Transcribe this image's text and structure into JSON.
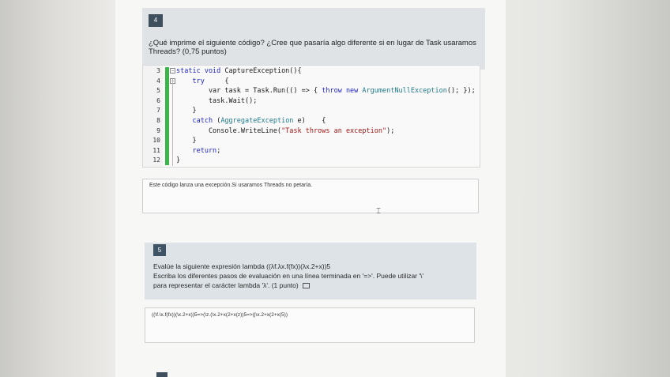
{
  "question4": {
    "number": "4",
    "prompt": "¿Qué imprime el siguiente código? ¿Cree que pasaría algo diferente si en lugar de Task usaramos Threads? (0,75 puntos)",
    "code_lines": [
      {
        "n": "3",
        "parts": [
          {
            "t": "static void ",
            "c": "kw"
          },
          {
            "t": "CaptureException(){",
            "c": ""
          }
        ]
      },
      {
        "n": "4",
        "parts": [
          {
            "t": "    try",
            "c": "kw"
          },
          {
            "t": "     {",
            "c": ""
          }
        ]
      },
      {
        "n": "5",
        "parts": [
          {
            "t": "        var task = Task.Run(() => { ",
            "c": ""
          },
          {
            "t": "throw new ",
            "c": "kw"
          },
          {
            "t": "ArgumentNullException",
            "c": "ty"
          },
          {
            "t": "(); });",
            "c": ""
          }
        ]
      },
      {
        "n": "6",
        "parts": [
          {
            "t": "        task.Wait();",
            "c": ""
          }
        ]
      },
      {
        "n": "7",
        "parts": [
          {
            "t": "    }",
            "c": ""
          }
        ]
      },
      {
        "n": "8",
        "parts": [
          {
            "t": "    catch ",
            "c": "kw"
          },
          {
            "t": "(",
            "c": ""
          },
          {
            "t": "AggregateException",
            "c": "ty"
          },
          {
            "t": " e)    {",
            "c": ""
          }
        ]
      },
      {
        "n": "9",
        "parts": [
          {
            "t": "        Console.WriteLine(",
            "c": ""
          },
          {
            "t": "\"Task throws an exception\"",
            "c": "st"
          },
          {
            "t": ");",
            "c": ""
          }
        ]
      },
      {
        "n": "10",
        "parts": [
          {
            "t": "    }",
            "c": ""
          }
        ]
      },
      {
        "n": "11",
        "parts": [
          {
            "t": "    return",
            "c": "kw"
          },
          {
            "t": ";",
            "c": ""
          }
        ]
      },
      {
        "n": "12",
        "parts": [
          {
            "t": "}",
            "c": ""
          }
        ]
      }
    ],
    "answer": "Este código lanza una excepción.Si usaramos Threads no petaría."
  },
  "question5": {
    "number": "5",
    "prompt_line1": "Evalúe la siguiente expresión lambda ((λf.λx.f(fx))(λx.2+x))5",
    "prompt_line2": "Escriba los diferentes pasos de evaluación en una línea terminada en '=>'. Puede utilizar '\\'",
    "prompt_line3": "para representar el carácter lambda 'λ'. (1 punto)",
    "answer": "((\\f.\\x.f(fx))(\\x.2+x))5=>(\\z.(\\x.2+x(2+x(z))5=>(|\\x.2+x(2+x(5))"
  }
}
